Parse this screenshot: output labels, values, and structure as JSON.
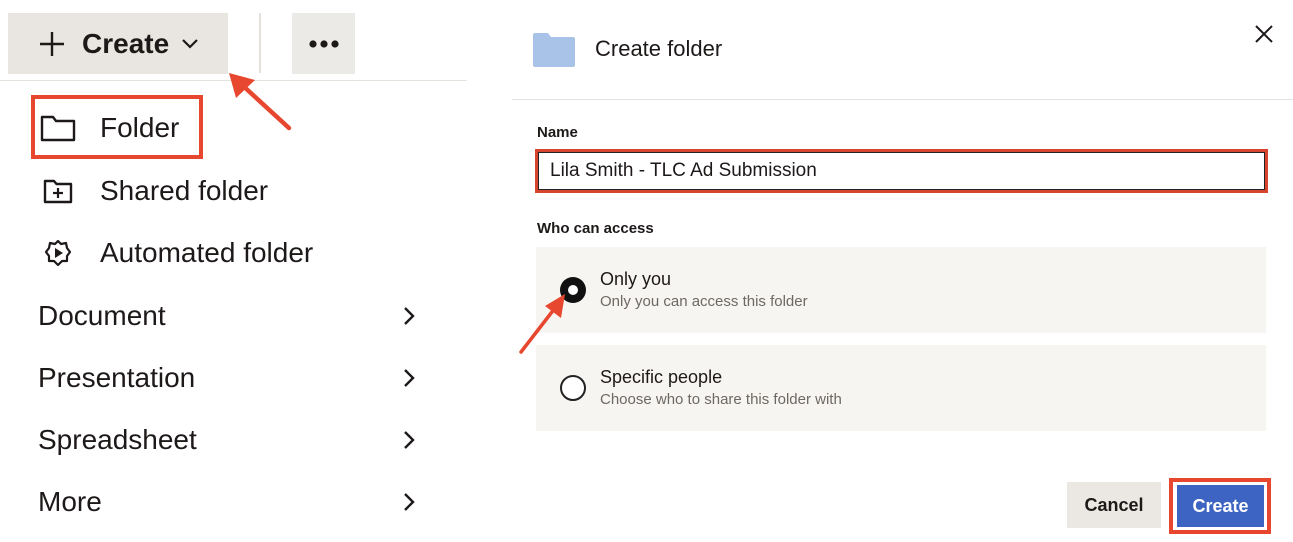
{
  "toolbar": {
    "create_label": "Create",
    "more_label": "•••"
  },
  "menu": {
    "items": [
      {
        "label": "Folder",
        "icon": "folder-icon"
      },
      {
        "label": "Shared folder",
        "icon": "shared-folder-icon"
      },
      {
        "label": "Automated folder",
        "icon": "automated-folder-icon"
      },
      {
        "label": "Document",
        "icon": "chevron-right-icon"
      },
      {
        "label": "Presentation",
        "icon": "chevron-right-icon"
      },
      {
        "label": "Spreadsheet",
        "icon": "chevron-right-icon"
      },
      {
        "label": "More",
        "icon": "chevron-right-icon"
      }
    ]
  },
  "dialog": {
    "title": "Create folder",
    "name_label": "Name",
    "name_value": "Lila Smith - TLC Ad Submission",
    "access_label": "Who can access",
    "options": [
      {
        "title": "Only you",
        "subtitle": "Only you can access this folder",
        "selected": true
      },
      {
        "title": "Specific people",
        "subtitle": "Choose who to share this folder with",
        "selected": false
      }
    ],
    "cancel_label": "Cancel",
    "create_label": "Create"
  },
  "colors": {
    "highlight": "#e8472f",
    "primary_button": "#3d64c2",
    "folder_icon": "#a9c3e8"
  }
}
